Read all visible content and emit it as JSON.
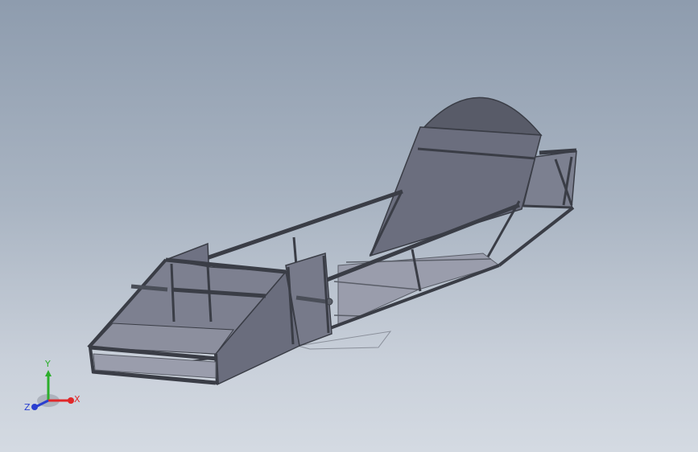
{
  "viewport": {
    "background_top": "#8e9cae",
    "background_bottom": "#d4dae2"
  },
  "model": {
    "frame_color": "#4a4e58",
    "panel_light": "#7d8090",
    "panel_dark": "#606372",
    "floor_color": "#9a9dac",
    "headrest_color": "#585b68"
  },
  "triad": {
    "x_label": "X",
    "y_label": "Y",
    "z_label": "Z",
    "x_color": "#e0282a",
    "y_color": "#2cae2c",
    "z_color": "#2a3fd0"
  }
}
